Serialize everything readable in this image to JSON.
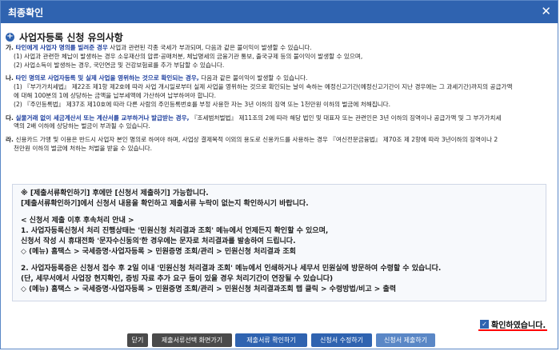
{
  "window": {
    "title": "최종확인",
    "close_glyph": "✕"
  },
  "section": {
    "title": "사업자등록 신청 유의사항"
  },
  "notes": [
    {
      "type": "head",
      "prefix": "가. ",
      "emph": "타인에게 사업자 명의를 빌려준 경우",
      "rest": " 사업과 관련된 각종 국세가 부과되며, 다음과 같은 불이익이 발생할 수 있습니다."
    },
    {
      "type": "sub",
      "text": "(1) 사업과 관련한 체납이 발생하는 경우 소유재산의 압류·공매처분, 체납명세의 금융기관 통보, 출국규제 등의 불이익이 발생할 수 있으며,"
    },
    {
      "type": "sub",
      "text": "(2) 사업소득이 발생하는 경우, 국민연금 및 건강보험료를 추가 부담할 수 있습니다."
    },
    {
      "type": "gap"
    },
    {
      "type": "head",
      "prefix": "나. ",
      "emph": "타인 명의로 사업자등록 및 실제 사업을 영위하는 것으로 확인되는 경우,",
      "rest": " 다음과 같은 불이익이 발생할 수 있습니다."
    },
    {
      "type": "sub",
      "text": "(1) 『부가가치세법』 제22조 제1항 제2호에 따라 사업 개시일로부터 실제 사업을 영위하는 것으로 확인되는 날이 속하는 예정신고기간(예정신고기간이 지난 경우에는 그 과세기간)까지의 공급가액"
    },
    {
      "type": "indent",
      "text": "에 대해 100분의 1에 상당하는 금액을 납부세액에 가산하여 납부하여야 합니다."
    },
    {
      "type": "sub",
      "text": "(2) 『주민등록법』 제37조 제10호에 따라 다른 사람의 주민등록번호를 부정 사용한 자는 3년 이하의 징역 또는 1천만원 이하의 벌금에 처해집니다."
    },
    {
      "type": "gap"
    },
    {
      "type": "head",
      "prefix": "다. ",
      "emph": "실물거래 없이 세금계산서 또는 계산서를 교부하거나 발급받는 경우,",
      "rest": " 『조세범처벌법』 제11조의 2에 따라 해당 법인 및 대표자 또는 관련인은 3년 이하의 징역이나 공급가액 및 그 부가가치세"
    },
    {
      "type": "indent",
      "text": "액의 2배 이하에 상당하는 벌금이 부과될 수 있습니다."
    },
    {
      "type": "gap"
    },
    {
      "type": "head",
      "prefix": "라. ",
      "emph": "",
      "rest": "신용카드 가맹 및 이용은 반드시 사업자 본인 명의로 하여야 하며, 사업상 결제목적 이외의 용도로 신용카드를 사용하는 경우 『여신전문금융법』 제70조 제 2항에 따라 3년이하의 징역이나 2"
    },
    {
      "type": "indent",
      "text": "천만원 이하의 벌금에 처하는 처벌을 받을 수 있습니다."
    }
  ],
  "box": {
    "lines": [
      {
        "text": "※  [제출서류확인하기] 후에만 [신청서 제출하기] 가능합니다."
      },
      {
        "text": "     [제출서류확인하기]에서 신청서 내용을 확인하고 제출서류 누락이 없는지 확인하시기 바랍니다."
      },
      {
        "text": "",
        "spacer": true
      },
      {
        "text": "< 신청서 제출 이후 후속처리 안내 >"
      },
      {
        "text": "1.  사업자등록신청서 처리 진행상태는 '민원신청 처리결과 조회' 메뉴에서 언제든지 확인할 수 있으며,"
      },
      {
        "text": "     신청서 작성 시 휴대전화 '문자수신동의'한 경우에는 문자로 처리결과를 발송하여 드립니다."
      },
      {
        "text": "     ◇ (메뉴) 홈택스 > 국세증명·사업자등록 > 민원증명 조회/관리 > 민원신청 처리결과 조회"
      },
      {
        "text": "",
        "spacer": true
      },
      {
        "text": "2.  사업자등록증은 신청서 접수 후 2일 이내 '민원신청 처리결과 조회' 메뉴에서 인쇄하거나 세무서 민원실에 방문하여 수령할 수 있습니다."
      },
      {
        "text": "     (단, 세무서에서 사업장 현지확인, 증빙 자료 추가 요구 등이 있을 경우 처리기간이 연장될 수 있습니다)"
      },
      {
        "text": "     ◇ (메뉴) 홈택스 > 국세증명·사업자등록 > 민원증명 조회/관리 > 민원신청 처리결과조회 탭 클릭 > 수령방법/비고 > 출력"
      }
    ]
  },
  "confirm": {
    "label": "확인하였습니다.",
    "checked": true,
    "check_glyph": "✓"
  },
  "buttons": {
    "close": "닫기",
    "doc_select": "제출서류선택 화면가기",
    "doc_confirm": "제출서류 확인하기",
    "edit": "신청서 수정하기",
    "submit": "신청서 제출하기"
  },
  "colors": {
    "title_bar": "#2f63b0",
    "dark_button": "#4a4a4a",
    "blue_button": "#2f63b0",
    "underline": "#ff0000",
    "emph_text": "#1e3f9e"
  }
}
